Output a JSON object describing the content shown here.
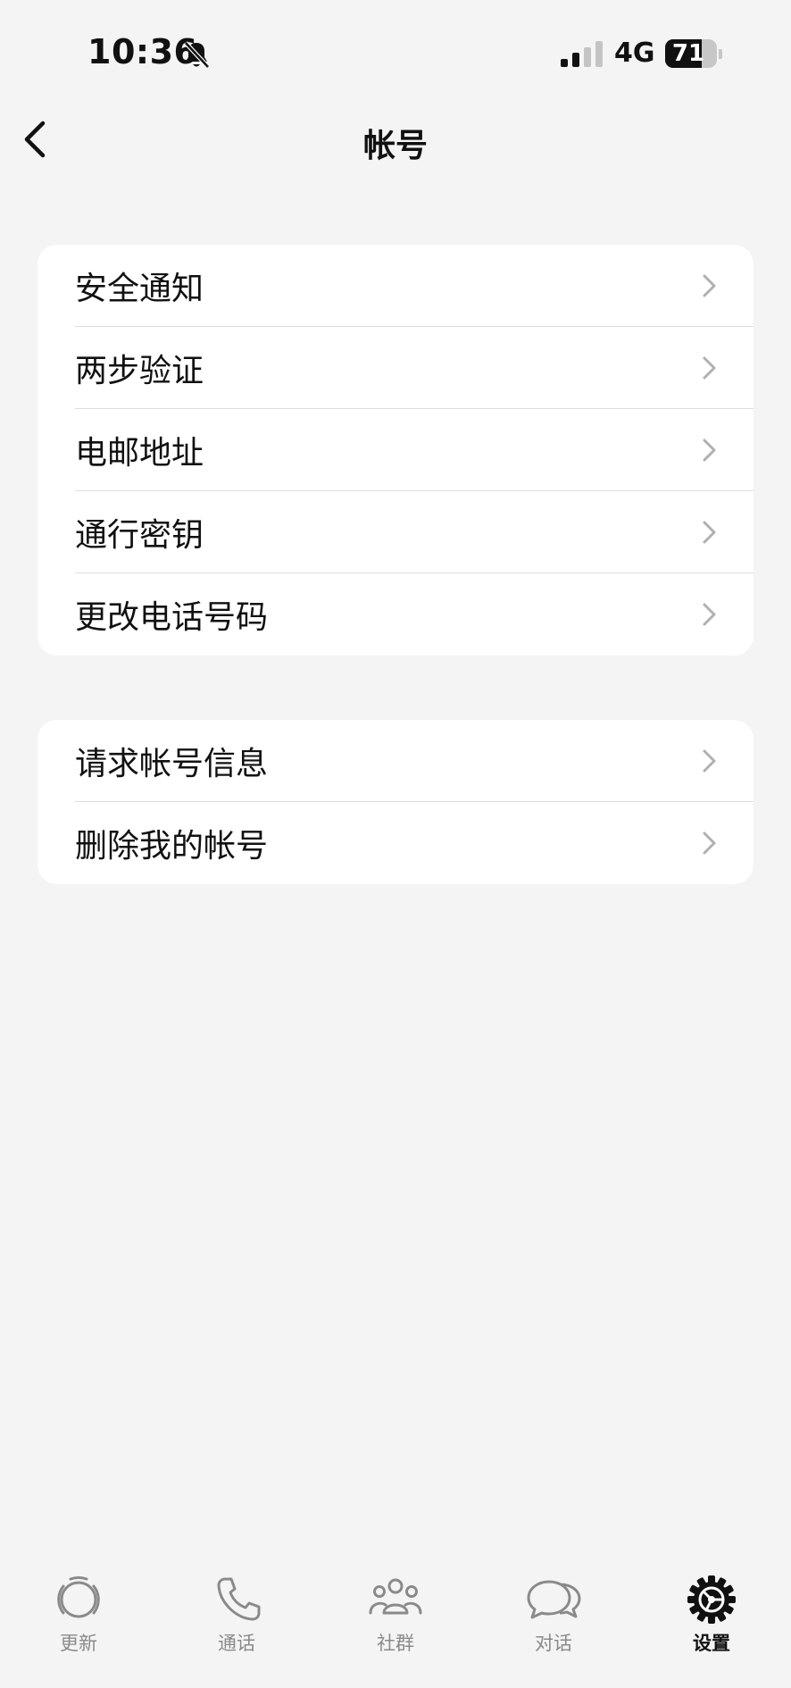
{
  "status_bar": {
    "time": "10:36",
    "network": "4G",
    "battery_level": 71,
    "battery_text": "71"
  },
  "header": {
    "title": "帐号"
  },
  "groups": [
    {
      "items": [
        {
          "label": "安全通知"
        },
        {
          "label": "两步验证"
        },
        {
          "label": "电邮地址"
        },
        {
          "label": "通行密钥"
        },
        {
          "label": "更改电话号码"
        }
      ]
    },
    {
      "items": [
        {
          "label": "请求帐号信息"
        },
        {
          "label": "删除我的帐号"
        }
      ]
    }
  ],
  "tab_bar": {
    "tabs": [
      {
        "label": "更新",
        "icon": "updates-icon"
      },
      {
        "label": "通话",
        "icon": "phone-icon"
      },
      {
        "label": "社群",
        "icon": "communities-icon"
      },
      {
        "label": "对话",
        "icon": "chats-icon"
      },
      {
        "label": "设置",
        "icon": "settings-icon"
      }
    ],
    "active_index": 4
  },
  "colors": {
    "background": "#f4f4f4",
    "card": "#ffffff",
    "text": "#111111",
    "secondary_text": "#8a8a8a",
    "chevron": "#b0b0b0",
    "divider": "#dedede"
  }
}
